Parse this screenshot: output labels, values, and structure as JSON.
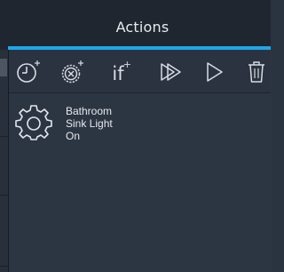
{
  "header": {
    "title": "Actions"
  },
  "toolbar": {
    "tools": [
      {
        "name": "add-time-trigger",
        "icon": "clock-plus-icon"
      },
      {
        "name": "add-delay",
        "icon": "timer-plus-icon"
      },
      {
        "name": "add-condition",
        "icon": "if-plus-icon",
        "label": "if",
        "superscript": "+"
      },
      {
        "name": "run-from-here",
        "icon": "double-play-icon"
      },
      {
        "name": "run",
        "icon": "play-icon"
      },
      {
        "name": "delete",
        "icon": "trash-icon"
      }
    ]
  },
  "actions": [
    {
      "icon": "gear-icon",
      "lines": [
        "Bathroom",
        "Sink Light",
        "On"
      ]
    }
  ],
  "colors": {
    "accent": "#1ea6e8",
    "background": "#2c3542",
    "header": "#1f2630",
    "text": "#e6eaee"
  }
}
